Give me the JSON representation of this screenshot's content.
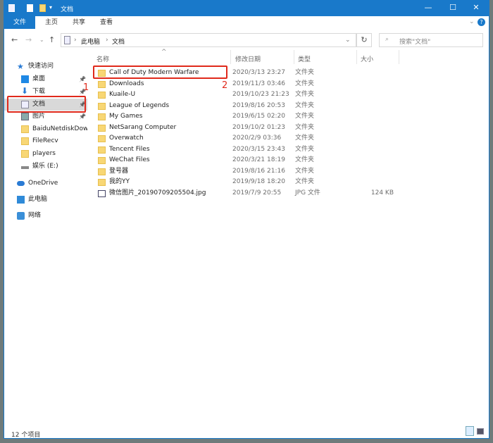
{
  "window": {
    "title": "文档",
    "minimize": "—",
    "maximize": "☐",
    "close": "✕"
  },
  "ribbon": {
    "tabs": [
      "文件",
      "主页",
      "共享",
      "查看"
    ],
    "help": "?",
    "expand": "⌄"
  },
  "address": {
    "back": "←",
    "forward": "→",
    "recent": "⌄",
    "up": "↑",
    "crumbs": [
      "此电脑",
      "文档"
    ],
    "separator": "›",
    "dropdown": "⌄",
    "refresh": "↻",
    "search_placeholder": "搜索\"文档\""
  },
  "nav": {
    "items": [
      {
        "label": "快速访问",
        "icon": "star-icon"
      },
      {
        "label": "桌面",
        "icon": "desktop-icon",
        "pinned": true
      },
      {
        "label": "下载",
        "icon": "download-icon",
        "pinned": true
      },
      {
        "label": "文档",
        "icon": "document-icon",
        "pinned": true,
        "selected": true
      },
      {
        "label": "图片",
        "icon": "picture-icon",
        "pinned": true
      },
      {
        "label": "BaiduNetdiskDownl",
        "icon": "folder-icon"
      },
      {
        "label": "FileRecv",
        "icon": "folder-icon"
      },
      {
        "label": "players",
        "icon": "folder-icon"
      },
      {
        "label": "娱乐 (E:)",
        "icon": "drive-icon"
      },
      {
        "label": "OneDrive",
        "icon": "cloud-icon"
      },
      {
        "label": "此电脑",
        "icon": "computer-icon"
      },
      {
        "label": "网络",
        "icon": "network-icon"
      }
    ]
  },
  "columns": {
    "name": "名称",
    "date": "修改日期",
    "type": "类型",
    "size": "大小",
    "sort": "^"
  },
  "files": [
    {
      "name": "Call of Duty Modern Warfare",
      "date": "2020/3/13 23:27",
      "type": "文件夹",
      "size": ""
    },
    {
      "name": "Downloads",
      "date": "2019/11/3 03:46",
      "type": "文件夹",
      "size": ""
    },
    {
      "name": "Kuaile-U",
      "date": "2019/10/23 21:23",
      "type": "文件夹",
      "size": ""
    },
    {
      "name": "League of Legends",
      "date": "2019/8/16 20:53",
      "type": "文件夹",
      "size": ""
    },
    {
      "name": "My Games",
      "date": "2019/6/15 02:20",
      "type": "文件夹",
      "size": ""
    },
    {
      "name": "NetSarang Computer",
      "date": "2019/10/2 01:23",
      "type": "文件夹",
      "size": ""
    },
    {
      "name": "Overwatch",
      "date": "2020/2/9 03:36",
      "type": "文件夹",
      "size": ""
    },
    {
      "name": "Tencent Files",
      "date": "2020/3/15 23:43",
      "type": "文件夹",
      "size": ""
    },
    {
      "name": "WeChat Files",
      "date": "2020/3/21 18:19",
      "type": "文件夹",
      "size": ""
    },
    {
      "name": "登号器",
      "date": "2019/8/16 21:16",
      "type": "文件夹",
      "size": ""
    },
    {
      "name": "我的YY",
      "date": "2019/9/18 18:20",
      "type": "文件夹",
      "size": ""
    },
    {
      "name": "微信图片_20190709205504.jpg",
      "date": "2019/7/9 20:55",
      "type": "JPG 文件",
      "size": "124 KB"
    }
  ],
  "annotations": [
    "1",
    "2"
  ],
  "status": "12 个项目",
  "colors": {
    "accent": "#1979ca",
    "highlight": "#e0291b"
  }
}
